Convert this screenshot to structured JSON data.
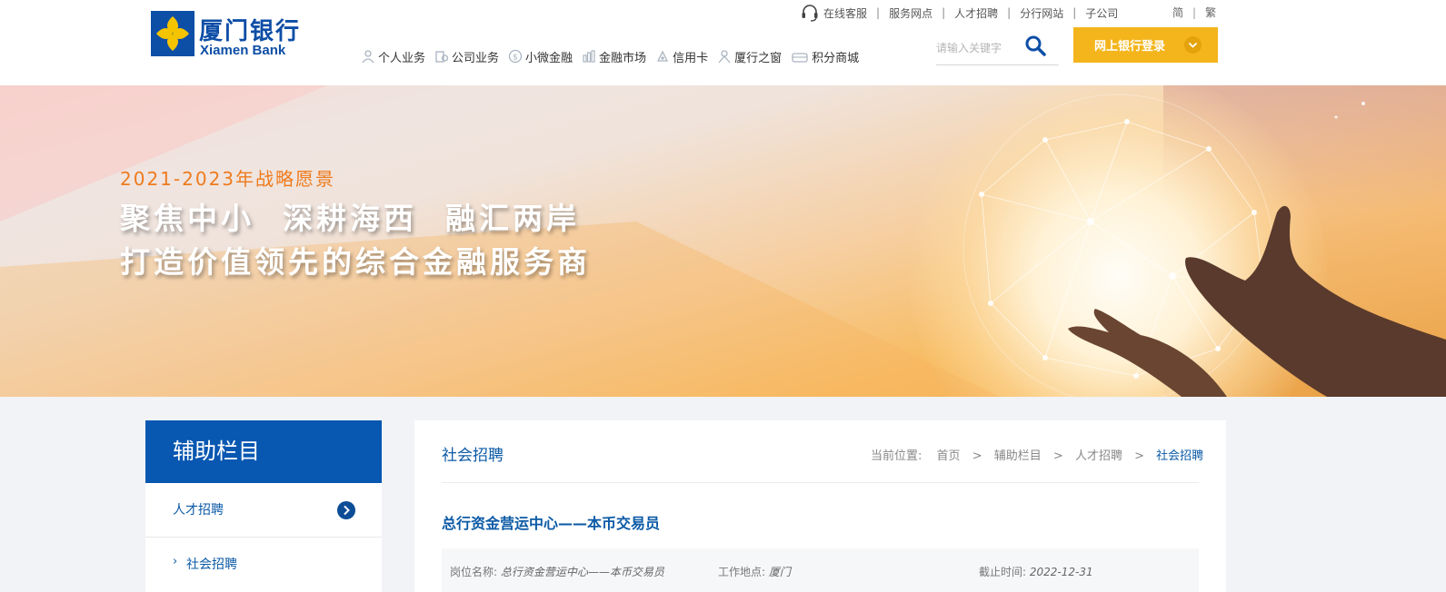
{
  "header": {
    "logo": {
      "cn": "厦门银行",
      "en": "Xiamen Bank"
    },
    "top_links": [
      "在线客服",
      "服务网点",
      "人才招聘",
      "分行网站",
      "子公司"
    ],
    "languages": [
      "简",
      "繁"
    ],
    "nav": [
      {
        "label": "个人业务",
        "icon": "person-icon"
      },
      {
        "label": "公司业务",
        "icon": "building-icon"
      },
      {
        "label": "小微金融",
        "icon": "coin-icon"
      },
      {
        "label": "金融市场",
        "icon": "market-icon"
      },
      {
        "label": "信用卡",
        "icon": "card-icon"
      },
      {
        "label": "厦行之窗",
        "icon": "window-icon"
      },
      {
        "label": "积分商城",
        "icon": "gift-icon"
      }
    ],
    "search_placeholder": "请输入关键字",
    "login_label": "网上银行登录"
  },
  "banner": {
    "slogan_year": "2021-2023年战略愿景",
    "slogan_line1": "聚焦中小  深耕海西  融汇两岸",
    "slogan_line2": "打造价值领先的综合金融服务商"
  },
  "sidebar": {
    "title": "辅助栏目",
    "items": [
      {
        "label": "人才招聘"
      },
      {
        "label": "社会招聘"
      }
    ]
  },
  "content": {
    "title": "社会招聘",
    "breadcrumb": {
      "prefix": "当前位置:",
      "items": [
        "首页",
        "辅助栏目",
        "人才招聘",
        "社会招聘"
      ]
    },
    "job": {
      "title": "总行资金营运中心——本币交易员",
      "fields": [
        {
          "key": "岗位名称:",
          "value": "总行资金营运中心——本币交易员"
        },
        {
          "key": "工作地点:",
          "value": "厦门"
        },
        {
          "key": "截止时间:",
          "value": "2022-12-31"
        }
      ]
    }
  },
  "colors": {
    "brand_blue": "#0857b1",
    "accent_yellow": "#f4b51c",
    "banner_orange": "#ee7b1e"
  }
}
